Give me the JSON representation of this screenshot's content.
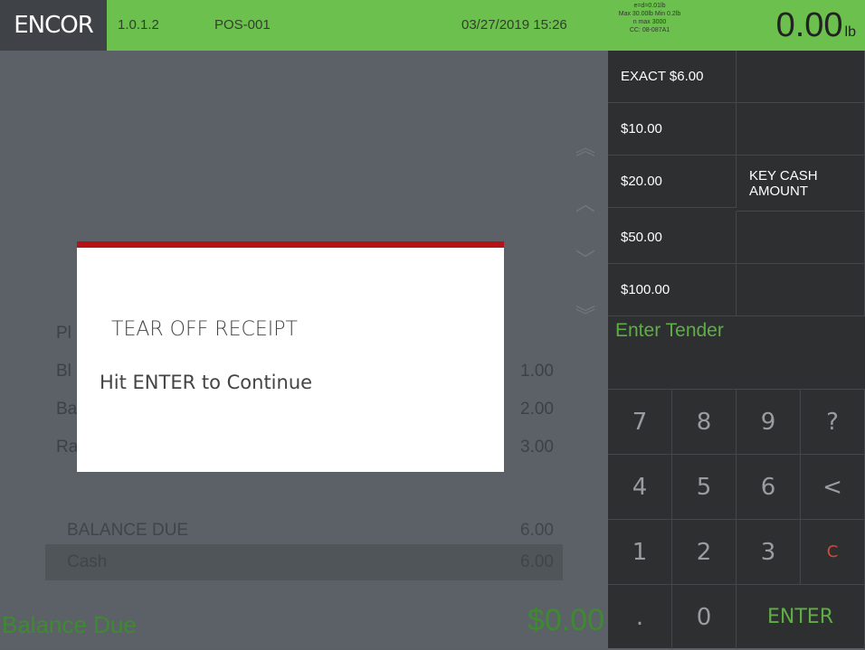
{
  "topbar": {
    "logo": "ENCOR",
    "version": "1.0.1.2",
    "terminal": "POS-001",
    "datetime": "03/27/2019 15:26",
    "scale_line1": "e=d=0.01lb",
    "scale_line2": "Max 30.00lb  Min 0.2lb",
    "scale_line3": "n max 3000",
    "scale_line4": "CC: 08-087A1",
    "weight": "0.00",
    "weight_unit": "lb"
  },
  "items": [
    {
      "name": "Pl",
      "amount": ""
    },
    {
      "name": "Bl",
      "amount": "1.00"
    },
    {
      "name": "Ba",
      "amount": "2.00"
    },
    {
      "name": "Ra",
      "amount": "3.00"
    }
  ],
  "balance": {
    "label": "BALANCE DUE",
    "amount": "6.00"
  },
  "cash": {
    "label": "Cash",
    "amount": "6.00"
  },
  "footer": {
    "label": "Balance Due",
    "amount": "$0.00"
  },
  "dialog": {
    "title": "TEAR OFF RECEIPT",
    "message": "Hit ENTER to Continue"
  },
  "tenders": {
    "exact": "EXACT $6.00",
    "t10": "$10.00",
    "t20": "$20.00",
    "t50": "$50.00",
    "t100": "$100.00",
    "key_cash": "KEY CASH AMOUNT"
  },
  "enter_tender": "Enter Tender",
  "keypad": {
    "k7": "7",
    "k8": "8",
    "k9": "9",
    "kq": "?",
    "k4": "4",
    "k5": "5",
    "k6": "6",
    "kback": "<",
    "k1": "1",
    "k2": "2",
    "k3": "3",
    "kclear": "C",
    "kdot": ".",
    "k0": "0",
    "kenter": "ENTER"
  },
  "icons": {
    "scroll_top": "double-chevron-up-icon",
    "scroll_up": "chevron-up-icon",
    "scroll_down": "chevron-down-icon",
    "scroll_bottom": "double-chevron-down-icon"
  }
}
